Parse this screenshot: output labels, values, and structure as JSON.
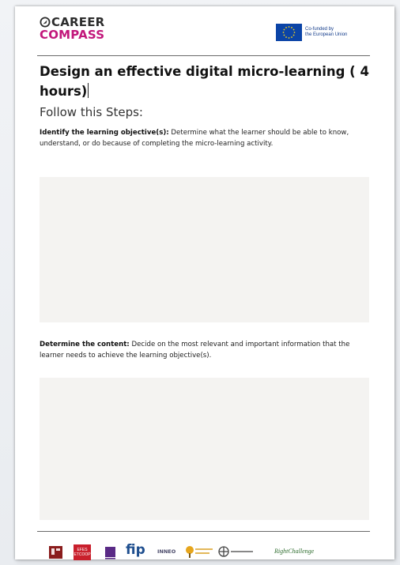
{
  "header": {
    "logo_line1": "CAREER",
    "logo_line2": "COMPASS",
    "eu_line1": "Co-funded by",
    "eu_line2": "the European Union"
  },
  "document": {
    "title": "Design an effective digital micro-learning ( 4 hours)",
    "subtitle": "Follow this Steps:",
    "sections": [
      {
        "lead": "Identify the learning objective(s):",
        "text": "Determine what the learner should be able to know, understand, or do because of completing the micro-learning activity."
      },
      {
        "lead": "Determine the content:",
        "text": "Decide on the most relevant and important information that the learner needs to achieve the learning objective(s)."
      }
    ]
  },
  "footer": {
    "partner_logos": [
      "EFES ETCOOP",
      "fip",
      "INNEO",
      "RightChallenge"
    ]
  },
  "colors": {
    "brand_magenta": "#c2177b",
    "eu_blue": "#0b44a7",
    "answer_box": "#f4f3f1"
  }
}
